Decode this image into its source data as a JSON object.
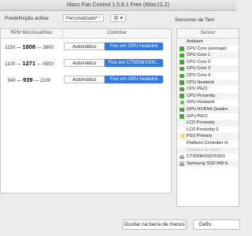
{
  "window": {
    "title": "Macs Fan Control 1.5.8.1 Free (iMac12,2)"
  },
  "toolbar": {
    "preset_label": "Predefinição activa:",
    "preset_value": "Personalizado*",
    "preset_arrow": "⌃",
    "gear_glyph": "⚙ ▾"
  },
  "sensors_title": "Sensores de Tem",
  "fan_table": {
    "col_rpm": "RPM Min/Atual/Max",
    "col_control": "Controlar",
    "rows": [
      {
        "min": "1150",
        "current": "1808",
        "max": "3800",
        "auto_label": "Automático",
        "fixed_label": "Fixo em GPU Heatsink"
      },
      {
        "min": "1100",
        "current": "1271",
        "max": "5500",
        "auto_label": "Automático",
        "fixed_label": "Fixo em CT500MX500..."
      },
      {
        "min": "940",
        "current": "939",
        "max": "2100",
        "auto_label": "Automático",
        "fixed_label": "Fixo em GPU Heatsink"
      }
    ],
    "dash": "—"
  },
  "sensor_table": {
    "header": "Sensor",
    "rows": [
      {
        "name": "Ambient",
        "icon": "none"
      },
      {
        "name": "CPU Core (average)",
        "icon": "chip"
      },
      {
        "name": "CPU Core 1",
        "icon": "chip"
      },
      {
        "name": "CPU Core 2",
        "icon": "chip"
      },
      {
        "name": "CPU Core 3",
        "icon": "chip"
      },
      {
        "name": "CPU Core 4",
        "icon": "chip"
      },
      {
        "name": "CPU Heatsink",
        "icon": "chip"
      },
      {
        "name": "CPU PECI",
        "icon": "chip"
      },
      {
        "name": "CPU Proximity",
        "icon": "chip"
      },
      {
        "name": "GPU Heatsink",
        "icon": "gpu"
      },
      {
        "name": "GPU NVIDIA Quadro",
        "icon": "chip"
      },
      {
        "name": "GPU PECI",
        "icon": "chip"
      },
      {
        "name": "LCD Proximity",
        "icon": "none"
      },
      {
        "name": "LCD Proximity 2",
        "icon": "none"
      },
      {
        "name": "PSU Primary",
        "icon": "bolt"
      },
      {
        "name": "Platform Controller H",
        "icon": "none"
      },
      {
        "name": "Unidades de Disco",
        "icon": "none"
      },
      {
        "name": "CT500MX500SSD1",
        "icon": "disk"
      },
      {
        "name": "Samsung SSD 840 E",
        "icon": "disk"
      }
    ]
  },
  "buttons": {
    "hide": "Ocultar na barra de menus",
    "prefs": "Defin"
  }
}
